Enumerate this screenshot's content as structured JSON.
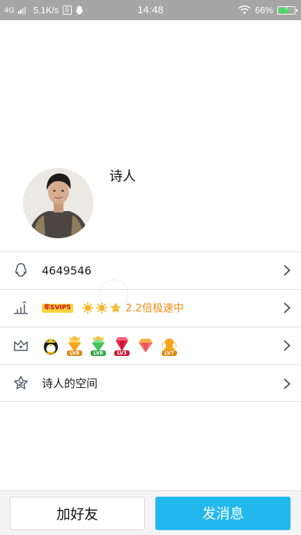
{
  "status_bar": {
    "network": "4G",
    "speed": "5.1K/s",
    "s_badge": "S",
    "time": "14:48",
    "battery": "66%",
    "battery_level": 0.66,
    "icons": [
      "signal-icon",
      "sim-s-icon",
      "qq-penguin-icon",
      "wifi-icon",
      "battery-icon"
    ]
  },
  "profile": {
    "nickname": "诗人",
    "avatar_icon": "avatar-photo"
  },
  "rows": [
    {
      "icon": "qq-penguin-icon",
      "text": "4649546"
    },
    {
      "icon": "stats-chart-icon",
      "vip_badge": "年SVIP5",
      "speed_text": "2.2倍极速中",
      "accent": "#f08c10"
    },
    {
      "icon": "crown-icon",
      "medals": [
        {
          "icon": "qq-penguin-medal-icon",
          "level": ""
        },
        {
          "icon": "crown-medal-icon",
          "level": "LV8"
        },
        {
          "icon": "green-crown-medal-icon",
          "level": "LV8"
        },
        {
          "icon": "red-diamond-medal-icon",
          "level": "LV3"
        },
        {
          "icon": "pink-diamond-medal-icon",
          "level": ""
        },
        {
          "icon": "music-medal-icon",
          "level": "LV7"
        }
      ]
    },
    {
      "icon": "star-space-icon",
      "text": "诗人的空间"
    }
  ],
  "actions": {
    "add_friend": "加好友",
    "send_message": "发消息",
    "primary_color": "#22b8ee"
  }
}
